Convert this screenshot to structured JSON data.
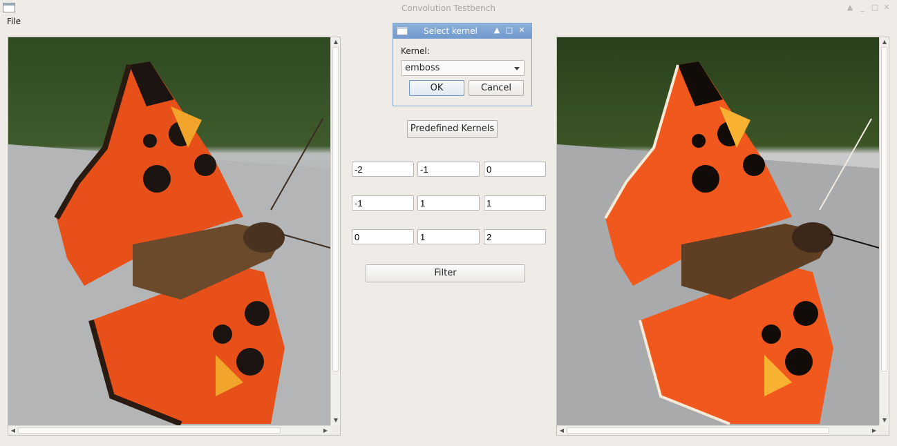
{
  "window": {
    "title": "Convolution Testbench"
  },
  "menu": {
    "file_label": "File"
  },
  "dialog": {
    "title": "Select kernel",
    "kernel_label": "Kernel:",
    "kernel_value": "emboss",
    "ok_label": "OK",
    "cancel_label": "Cancel"
  },
  "controls": {
    "predefined_label": "Predefined Kernels",
    "filter_label": "Filter"
  },
  "kernel_matrix": [
    [
      "-2",
      "-1",
      "0"
    ],
    [
      "-1",
      "1",
      "1"
    ],
    [
      "0",
      "1",
      "2"
    ]
  ]
}
